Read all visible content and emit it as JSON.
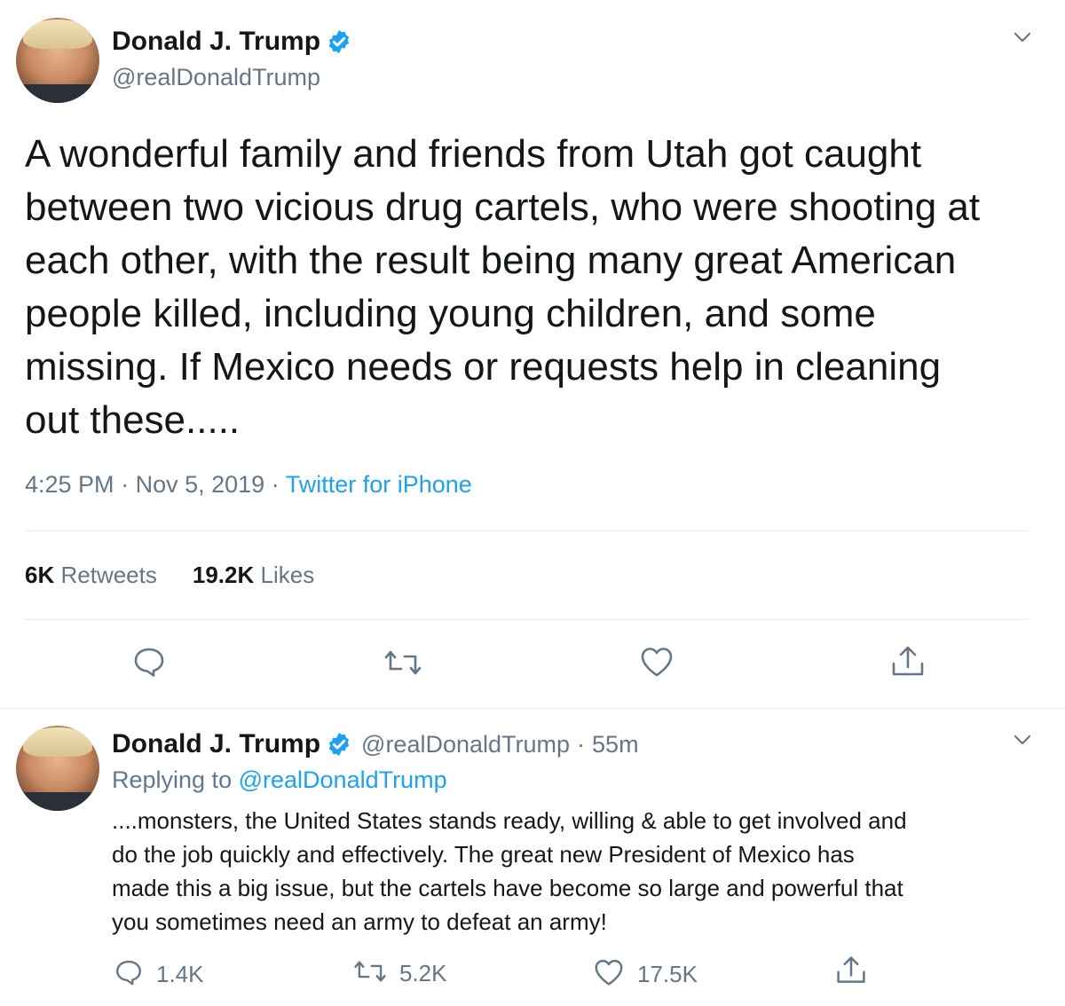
{
  "main_tweet": {
    "display_name": "Donald J. Trump",
    "handle": "@realDonaldTrump",
    "text": "A wonderful family and friends from Utah got caught\nbetween two vicious drug cartels, who were shooting at\neach other, with the result being many great American\npeople killed, including young children, and some\nmissing. If Mexico needs or requests help in cleaning\nout these.....",
    "time": "4:25 PM",
    "date": "Nov 5, 2019",
    "separator": "·",
    "source": "Twitter for iPhone",
    "retweets_count": "6K",
    "retweets_label": "Retweets",
    "likes_count": "19.2K",
    "likes_label": "Likes",
    "icons": [
      "reply-icon",
      "retweet-icon",
      "like-icon",
      "share-icon",
      "chevron-down-icon",
      "verified-badge-icon"
    ]
  },
  "reply_tweet": {
    "display_name": "Donald J. Trump",
    "handle": "@realDonaldTrump",
    "separator": "·",
    "age": "55m",
    "replying_to_label": "Replying to",
    "replying_to_handle": "@realDonaldTrump",
    "text": "....monsters, the United States stands ready, willing & able to get involved and\ndo the job quickly and effectively. The great new President of Mexico has\nmade this a big issue, but the cartels have become so large and powerful that\nyou sometimes need an army to defeat an army!",
    "reply_count": "1.4K",
    "retweet_count": "5.2K",
    "like_count": "17.5K"
  },
  "colors": {
    "accent": "#1da1f2",
    "secondary_text": "#657786",
    "primary_text": "#14171a",
    "divider": "#e6ecf0"
  }
}
